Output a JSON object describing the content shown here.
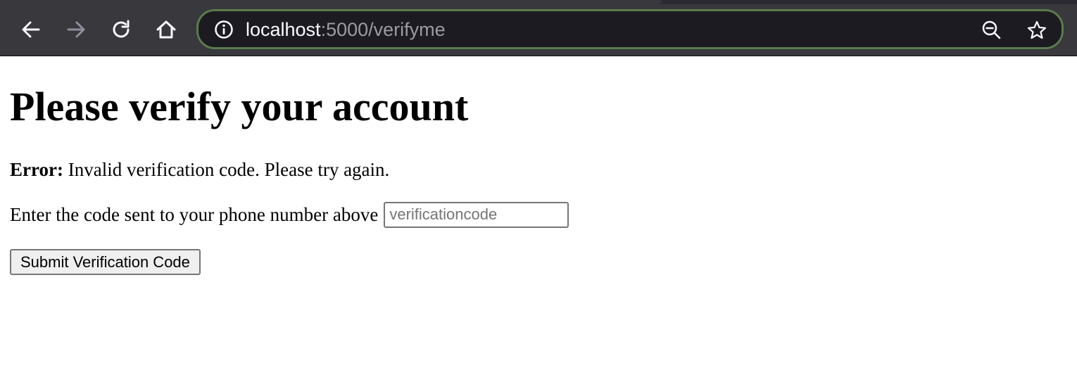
{
  "browser": {
    "url_host": "localhost",
    "url_rest": ":5000/verifyme",
    "icons": {
      "back": "back-arrow-icon",
      "forward": "forward-arrow-icon",
      "reload": "reload-icon",
      "home": "home-icon",
      "info": "info-icon",
      "zoom": "zoom-out-icon",
      "bookmark": "star-icon"
    },
    "forward_enabled": false,
    "colors": {
      "toolbar": "#38383d",
      "urlbar": "#1c1b22",
      "urlbar_focus_border": "#5b7b4c"
    }
  },
  "page": {
    "title": "Please verify your account",
    "error_label": "Error:",
    "error_message": "Invalid verification code. Please try again.",
    "code_prompt": "Enter the code sent to your phone number above",
    "code_input": {
      "value": "",
      "placeholder": "verificationcode"
    },
    "submit_label": "Submit Verification Code"
  }
}
